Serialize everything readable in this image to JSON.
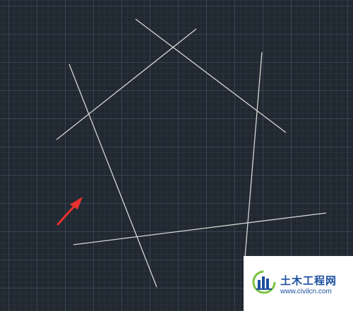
{
  "viewport": {
    "background_color": "#212830",
    "line_color": "#d6d6d6",
    "arrow_color": "#e8312f"
  },
  "watermark": {
    "name": "土木工程网",
    "url": "www.civilcn.com",
    "brand_color": "#1c4f9e",
    "accent_color": "#7cc242"
  }
}
